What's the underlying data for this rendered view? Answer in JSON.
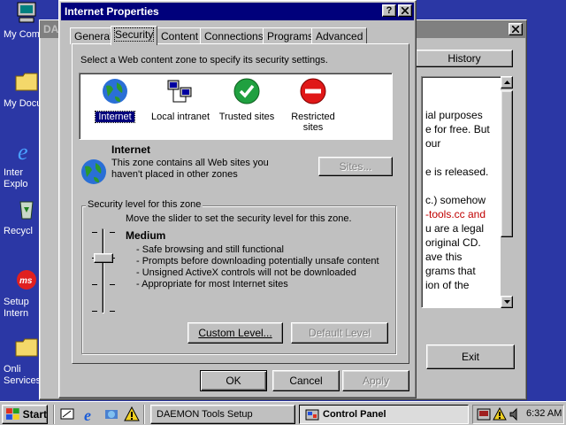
{
  "desktop": {
    "icons": [
      {
        "label": "My Com",
        "icon": "my-computer-icon"
      },
      {
        "label": "My Docu",
        "icon": "my-documents-icon"
      },
      {
        "label": "Inter",
        "label2": "Explo",
        "icon": "internet-explorer-icon"
      },
      {
        "label": "Recycl",
        "icon": "recycle-bin-icon"
      },
      {
        "label": "Setup",
        "label2": "Intern",
        "icon": "msn-setup-icon"
      },
      {
        "label": "Onli",
        "label2": "Services",
        "icon": "online-services-icon"
      }
    ]
  },
  "bg_window": {
    "title": "DAEMO",
    "history_label": "History",
    "text_lines": [
      "ial purposes",
      "e for free. But",
      "our",
      "",
      "e is released.",
      "",
      "c.) somehow",
      "-tools.cc and",
      "u are a legal",
      "original CD.",
      "ave this",
      "grams that",
      "ion of the"
    ],
    "link_line_index": 7,
    "link_color": "#c00000",
    "exit_label": "Exit"
  },
  "dialog": {
    "title": "Internet Properties",
    "help_label": "?",
    "close_label": "✕",
    "tabs": [
      "General",
      "Security",
      "Content",
      "Connections",
      "Programs",
      "Advanced"
    ],
    "active_tab": "Security",
    "zone_prompt": "Select a Web content zone to specify its security settings.",
    "zones": [
      {
        "label": "Internet",
        "icon": "globe-icon"
      },
      {
        "label": "Local intranet",
        "icon": "network-computers-icon"
      },
      {
        "label": "Trusted sites",
        "icon": "checkmark-icon"
      },
      {
        "label": "Restricted",
        "label2": "sites",
        "icon": "no-entry-icon"
      }
    ],
    "selected_zone": {
      "name": "Internet",
      "desc1": "This zone contains all Web sites you",
      "desc2": "haven't placed in other zones"
    },
    "sites_label": "Sites...",
    "security_level": {
      "legend": "Security level for this zone",
      "instruction": "Move the slider to set the security level for this zone.",
      "level": "Medium",
      "bullets": [
        "- Safe browsing and still functional",
        "- Prompts before downloading potentially unsafe content",
        "- Unsigned ActiveX controls will not be downloaded",
        "- Appropriate for most Internet sites"
      ],
      "custom_label": "Custom Level...",
      "default_label": "Default Level"
    },
    "ok_label": "OK",
    "cancel_label": "Cancel",
    "apply_label": "Apply"
  },
  "taskbar": {
    "start_label": "Start",
    "tasks": [
      {
        "label": "DAEMON Tools Setup",
        "active": false
      },
      {
        "label": "Control Panel",
        "active": true
      }
    ],
    "clock": "6:32 AM"
  },
  "colors": {
    "desktop": "#2b37a5",
    "title_active": "#00007b",
    "title_inactive": "#808080",
    "face": "#c0c0c0"
  }
}
